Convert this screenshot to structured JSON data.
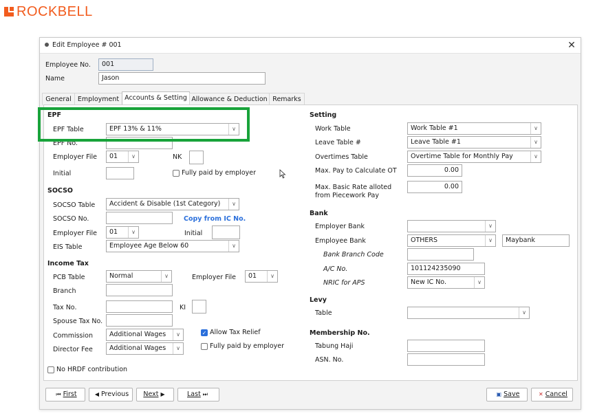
{
  "brand": {
    "name": "ROCKBELL",
    "color": "#f25c1e"
  },
  "window": {
    "title": "Edit Employee # 001",
    "close_icon": "close-icon"
  },
  "header": {
    "emp_no_label": "Employee No.",
    "emp_no_value": "001",
    "name_label": "Name",
    "name_value": "Jason"
  },
  "tabs": [
    {
      "label": "General"
    },
    {
      "label": "Employment"
    },
    {
      "label": "Accounts & Setting",
      "active": true
    },
    {
      "label": "Allowance & Deduction"
    },
    {
      "label": "Remarks"
    }
  ],
  "epf": {
    "heading": "EPF",
    "table_label": "EPF Table",
    "table_value": "EPF 13% & 11%",
    "no_label": "EPF No.",
    "no_value": "",
    "employer_file_label": "Employer File",
    "employer_file_value": "01",
    "nk_label": "NK",
    "nk_value": "",
    "initial_label": "Initial",
    "initial_value": "",
    "fully_paid_label": "Fully paid by employer",
    "fully_paid_checked": false
  },
  "socso": {
    "heading": "SOCSO",
    "table_label": "SOCSO Table",
    "table_value": "Accident & Disable (1st Category)",
    "no_label": "SOCSO No.",
    "no_value": "",
    "copy_link": "Copy from IC No.",
    "employer_file_label": "Employer File",
    "employer_file_value": "01",
    "initial_label": "Initial",
    "initial_value": "",
    "eis_label": "EIS Table",
    "eis_value": "Employee Age Below 60"
  },
  "income_tax": {
    "heading": "Income Tax",
    "pcb_label": "PCB Table",
    "pcb_value": "Normal",
    "employer_file_label": "Employer File",
    "employer_file_value": "01",
    "branch_label": "Branch",
    "branch_value": "",
    "tax_no_label": "Tax No.",
    "tax_no_value": "",
    "ki_label": "KI",
    "ki_value": "",
    "spouse_label": "Spouse Tax No.",
    "spouse_value": "",
    "commission_label": "Commission",
    "commission_value": "Additional Wages",
    "director_label": "Director Fee",
    "director_value": "Additional Wages",
    "allow_relief_label": "Allow Tax Relief",
    "allow_relief_checked": true,
    "fully_paid_label": "Fully paid by employer",
    "fully_paid_checked": false,
    "no_hrdf_label": "No HRDF contribution",
    "no_hrdf_checked": false
  },
  "setting": {
    "heading": "Setting",
    "work_label": "Work Table",
    "work_value": "Work Table #1",
    "leave_label": "Leave Table #",
    "leave_value": "Leave Table #1",
    "ot_label": "Overtimes Table",
    "ot_value": "Overtime Table for Monthly Pay",
    "maxpay_label": "Max. Pay to Calculate OT",
    "maxpay_value": "0.00",
    "maxbasic_label_1": "Max. Basic Rate alloted",
    "maxbasic_label_2": "from Piecework Pay",
    "maxbasic_value": "0.00"
  },
  "bank": {
    "heading": "Bank",
    "employer_bank_label": "Employer Bank",
    "employer_bank_value": "",
    "employee_bank_label": "Employee Bank",
    "employee_bank_value": "OTHERS",
    "employee_bank_name": "Maybank",
    "branch_code_label": "Bank Branch Code",
    "branch_code_value": "",
    "ac_label": "A/C No.",
    "ac_value": "101124235090",
    "nric_label": "NRIC for APS",
    "nric_value": "New IC No."
  },
  "levy": {
    "heading": "Levy",
    "table_label": "Table",
    "table_value": ""
  },
  "membership": {
    "heading": "Membership No.",
    "tabung_label": "Tabung Haji",
    "tabung_value": "",
    "asn_label": "ASN. No.",
    "asn_value": ""
  },
  "footer": {
    "first": "First",
    "previous": "Previous",
    "next": "Next",
    "last": "Last",
    "save": "Save",
    "cancel": "Cancel"
  },
  "colors": {
    "highlight": "#18a33a",
    "link": "#2a6fdb"
  }
}
